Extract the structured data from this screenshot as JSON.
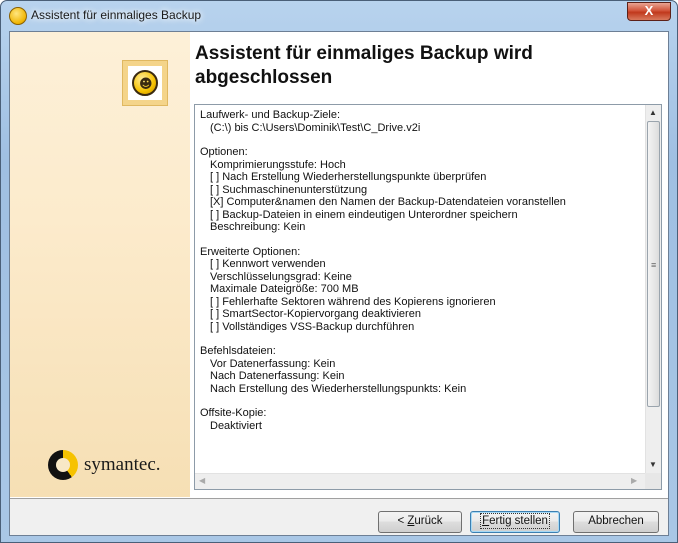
{
  "window": {
    "title": "Assistent für einmaliges Backup",
    "close_label": "X"
  },
  "main": {
    "heading": "Assistent für einmaliges Backup wird abgeschlossen"
  },
  "sidebar": {
    "brand": "symantec."
  },
  "summary": {
    "ziele_label": "Laufwerk- und Backup-Ziele:",
    "ziele_value": "(C:\\) bis C:\\Users\\Dominik\\Test\\C_Drive.v2i",
    "optionen_label": "Optionen:",
    "optionen": [
      "Komprimierungsstufe: Hoch",
      "[ ] Nach Erstellung Wiederherstellungspunkte überprüfen",
      "[ ] Suchmaschinenunterstützung",
      "[X] Computer&namen den Namen der Backup-Datendateien voranstellen",
      "[ ] Backup-Dateien in einem eindeutigen Unterordner speichern",
      "Beschreibung: Kein"
    ],
    "erweitert_label": "Erweiterte Optionen:",
    "erweitert": [
      "[ ] Kennwort verwenden",
      "Verschlüsselungsgrad: Keine",
      "Maximale Dateigröße: 700 MB",
      "[ ] Fehlerhafte Sektoren während des Kopierens ignorieren",
      "[ ] SmartSector-Kopiervorgang deaktivieren",
      "[ ] Vollständiges VSS-Backup durchführen"
    ],
    "befehle_label": "Befehlsdateien:",
    "befehle": [
      "Vor Datenerfassung: Kein",
      "Nach Datenerfassung: Kein",
      "Nach Erstellung des Wiederherstellungspunkts: Kein"
    ],
    "offsite_label": "Offsite-Kopie:",
    "offsite_value": "Deaktiviert"
  },
  "buttons": {
    "back_prefix": "< ",
    "back_key": "Z",
    "back_rest": "urück",
    "finish_key": "F",
    "finish_rest": "ertig stellen",
    "cancel": "Abbrechen"
  },
  "icons": {
    "title": "norton-ghost-icon",
    "logo": "norton-ghost-logo-icon",
    "brand": "symantec-logo-icon"
  }
}
